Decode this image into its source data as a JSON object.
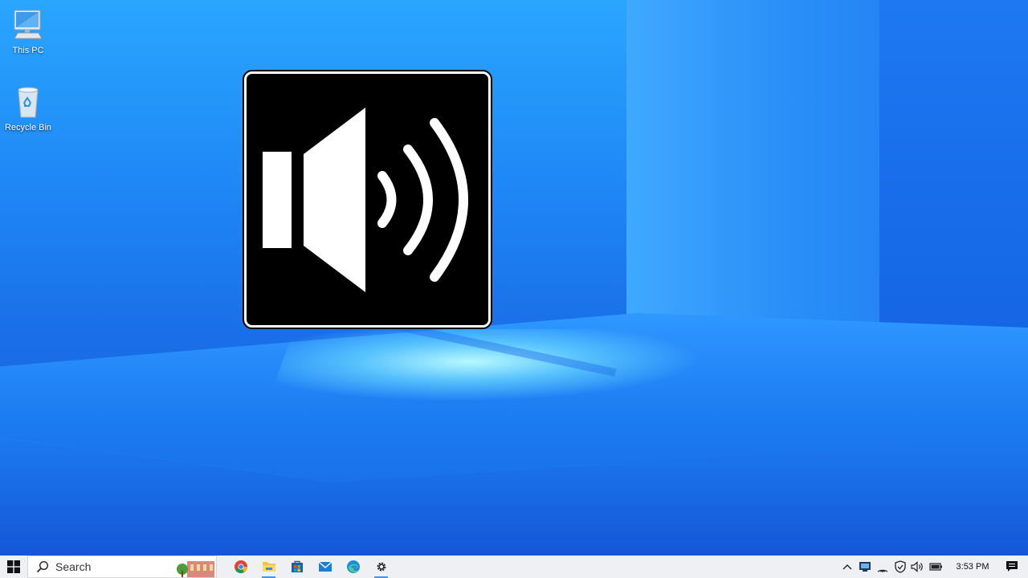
{
  "desktop": {
    "icons": [
      {
        "label": "This PC",
        "icon": "computer-icon"
      },
      {
        "label": "Recycle Bin",
        "icon": "recycle-bin-icon"
      }
    ],
    "overlay_icon": "speaker-volume-icon"
  },
  "taskbar": {
    "start_icon": "windows-logo-icon",
    "search_placeholder": "Search",
    "apps": [
      {
        "name": "chrome",
        "icon": "chrome-icon"
      },
      {
        "name": "file-explorer",
        "icon": "folder-icon"
      },
      {
        "name": "store",
        "icon": "store-icon"
      },
      {
        "name": "mail",
        "icon": "mail-icon"
      },
      {
        "name": "edge",
        "icon": "edge-icon"
      },
      {
        "name": "settings",
        "icon": "gear-icon"
      }
    ],
    "tray": {
      "icons": [
        "chevron-up-icon",
        "device-icon",
        "wifi-icon",
        "security-shield-icon",
        "volume-icon",
        "battery-icon"
      ],
      "time": "3:53 PM"
    },
    "notification_icon": "notification-icon"
  },
  "colors": {
    "taskbar_bg": "#eef0f4",
    "wallpaper_primary": "#1a6fe8",
    "active_indicator": "#4c8fd6"
  }
}
